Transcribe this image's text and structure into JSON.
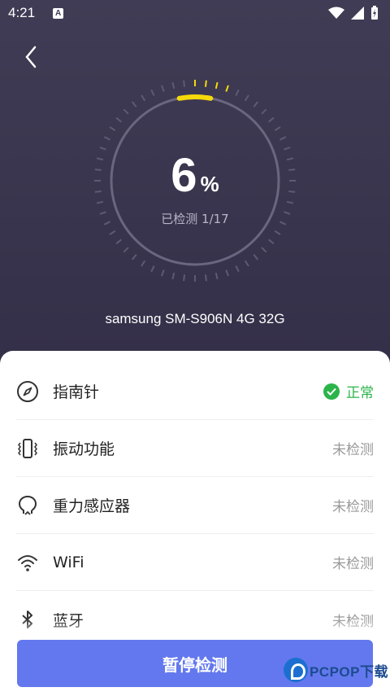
{
  "status_bar": {
    "time": "4:21",
    "notif_letter": "A"
  },
  "gauge": {
    "percent": "6",
    "percent_sign": "%",
    "progress_fraction": 0.06,
    "progress_text": "已检测 1/17"
  },
  "device": {
    "name": "samsung SM-S906N 4G 32G"
  },
  "items": [
    {
      "label": "指南针",
      "status": "正常",
      "ok": true,
      "icon": "compass-icon"
    },
    {
      "label": "振动功能",
      "status": "未检测",
      "ok": false,
      "icon": "vibration-icon"
    },
    {
      "label": "重力感应器",
      "status": "未检测",
      "ok": false,
      "icon": "gravity-sensor-icon"
    },
    {
      "label": "WiFi",
      "status": "未检测",
      "ok": false,
      "icon": "wifi-icon"
    },
    {
      "label": "蓝牙",
      "status": "未检测",
      "ok": false,
      "icon": "bluetooth-icon"
    }
  ],
  "action": {
    "pause_label": "暂停检测"
  },
  "watermark": {
    "text": "PCPOP下载"
  },
  "colors": {
    "accent": "#6378ee",
    "ok_green": "#2bb44a",
    "progress_yellow": "#f5d90a",
    "bg_dark": "#3a3550"
  }
}
